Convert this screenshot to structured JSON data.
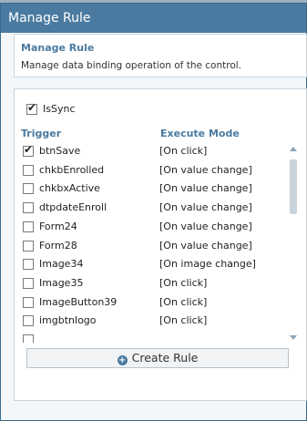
{
  "dialog": {
    "title": "Manage Rule"
  },
  "info": {
    "title": "Manage Rule",
    "description": "Manage data binding operation of the control."
  },
  "issync": {
    "label": "IsSync",
    "checked": true
  },
  "columns": {
    "trigger": "Trigger",
    "mode": "Execute Mode"
  },
  "rows": [
    {
      "trigger": "btnSave",
      "mode": "[On click]",
      "checked": true
    },
    {
      "trigger": "chkbEnrolled",
      "mode": "[On value change]",
      "checked": false
    },
    {
      "trigger": "chkbxActive",
      "mode": "[On value change]",
      "checked": false
    },
    {
      "trigger": "dtpdateEnroll",
      "mode": "[On value change]",
      "checked": false
    },
    {
      "trigger": "Form24",
      "mode": "[On value change]",
      "checked": false
    },
    {
      "trigger": "Form28",
      "mode": "[On value change]",
      "checked": false
    },
    {
      "trigger": "Image34",
      "mode": "[On image change]",
      "checked": false
    },
    {
      "trigger": "Image35",
      "mode": "[On click]",
      "checked": false
    },
    {
      "trigger": "ImageButton39",
      "mode": "[On click]",
      "checked": false
    },
    {
      "trigger": "imgbtnlogo",
      "mode": "[On click]",
      "checked": false
    },
    {
      "trigger": "",
      "mode": "",
      "checked": false
    }
  ],
  "create_button": {
    "label": "Create Rule",
    "icon": "plus-circle-icon"
  },
  "colors": {
    "titlebar": "#4a7aa0",
    "accent": "#4a7aa0"
  }
}
